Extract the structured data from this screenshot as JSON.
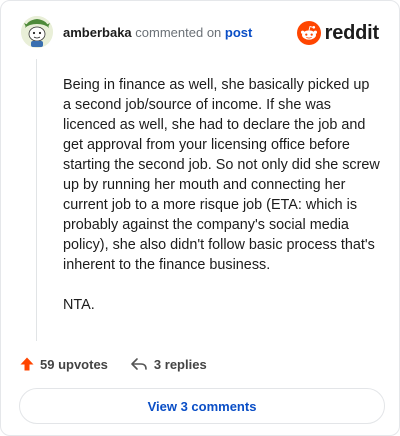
{
  "header": {
    "username": "amberbaka",
    "action_text": "commented on",
    "post_link": "post",
    "brand": "reddit"
  },
  "comment": {
    "paragraphs": [
      "Being in finance as well, she basically picked up a second job/source of income. If she was licenced as well, she had to declare the job and get approval from your licensing office before starting the second job. So not only did she screw up by running her mouth and connecting her current job to a more risque job (ETA: which is probably against the company's social media policy), she also didn't follow basic process that's inherent to the finance business.",
      "NTA."
    ]
  },
  "actions": {
    "upvotes": "59 upvotes",
    "replies": "3 replies"
  },
  "footer": {
    "view_button": "View 3 comments"
  },
  "colors": {
    "upvote": "#ff4500",
    "link": "#0a4ec6",
    "brand": "#ff4500"
  },
  "icons": [
    "avatar",
    "reddit-logo-icon",
    "upvote-arrow-icon",
    "reply-arrow-icon"
  ]
}
